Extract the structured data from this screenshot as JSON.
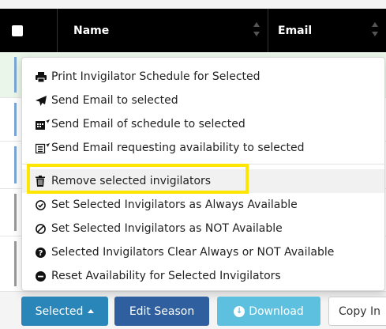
{
  "table": {
    "columns": [
      "Name",
      "Email"
    ]
  },
  "menu": {
    "items": [
      {
        "label": "Print Invigilator Schedule for Selected",
        "icon": "print-icon"
      },
      {
        "label": "Send Email to selected",
        "icon": "send-icon"
      },
      {
        "label": "Send Email of schedule to selected",
        "icon": "calendar-send-icon"
      },
      {
        "label": "Send Email requesting availability to selected",
        "icon": "list-send-icon"
      },
      {
        "label": "Remove selected invigilators",
        "icon": "trash-icon"
      },
      {
        "label": "Set Selected Invigilators as Always Available",
        "icon": "check-circle-icon"
      },
      {
        "label": "Set Selected Invigilators as NOT Available",
        "icon": "ban-icon"
      },
      {
        "label": "Selected Invigilators Clear Always or NOT Available",
        "icon": "question-circle-icon"
      },
      {
        "label": "Reset Availability for Selected Invigilators",
        "icon": "minus-circle-icon"
      }
    ]
  },
  "buttons": {
    "selected": "Selected",
    "edit_season": "Edit Season",
    "download": "Download",
    "copy": "Copy In"
  },
  "colors": {
    "highlight": "#ffe600",
    "selected_btn": "#2a86b8",
    "edit_btn": "#2f5f9e",
    "download_btn": "#5ec0df"
  }
}
